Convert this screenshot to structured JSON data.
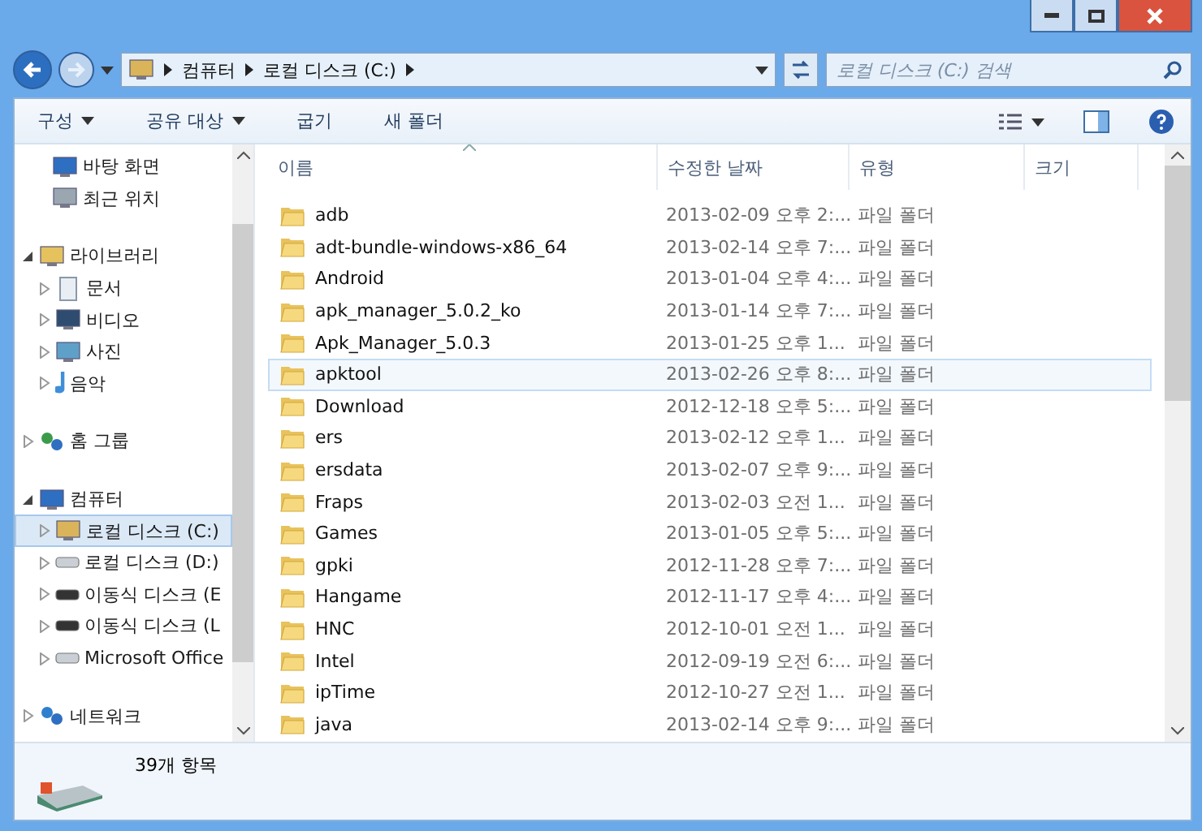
{
  "address": {
    "crumbs": [
      "컴퓨터",
      "로컬 디스크 (C:)"
    ]
  },
  "search": {
    "placeholder": "로컬 디스크 (C:) 검색"
  },
  "toolbar": [
    {
      "label": "구성",
      "dropdown": true
    },
    {
      "label": "공유 대상",
      "dropdown": true
    },
    {
      "label": "굽기",
      "dropdown": false
    },
    {
      "label": "새 폴더",
      "dropdown": false
    }
  ],
  "nav": {
    "favorites": [
      {
        "label": "바탕 화면",
        "kind": "desktop"
      },
      {
        "label": "최근 위치",
        "kind": "recent"
      }
    ],
    "tree": [
      {
        "label": "라이브러리",
        "kind": "library",
        "expanded": true,
        "selected": false,
        "children": [
          {
            "label": "문서",
            "kind": "documents",
            "expanded": false,
            "selected": false
          },
          {
            "label": "비디오",
            "kind": "video",
            "expanded": false,
            "selected": false
          },
          {
            "label": "사진",
            "kind": "pictures",
            "expanded": false,
            "selected": false
          },
          {
            "label": "음악",
            "kind": "music",
            "expanded": false,
            "selected": false
          }
        ]
      },
      {
        "label": "홈 그룹",
        "kind": "homegroup",
        "expanded": false,
        "selected": false
      },
      {
        "label": "컴퓨터",
        "kind": "computer",
        "expanded": true,
        "selected": false,
        "children": [
          {
            "label": "로컬 디스크 (C:)",
            "kind": "systemdisk",
            "expanded": false,
            "selected": true
          },
          {
            "label": "로컬 디스크 (D:)",
            "kind": "disk",
            "expanded": false,
            "selected": false
          },
          {
            "label": "이동식 디스크 (E",
            "kind": "removable",
            "expanded": false,
            "selected": false
          },
          {
            "label": "이동식 디스크 (L",
            "kind": "removable",
            "expanded": false,
            "selected": false
          },
          {
            "label": "Microsoft Office",
            "kind": "disk",
            "expanded": false,
            "selected": false
          }
        ]
      },
      {
        "label": "네트워크",
        "kind": "network",
        "expanded": false,
        "selected": false
      }
    ]
  },
  "table": {
    "columns": [
      {
        "label": "이름",
        "sorted": true
      },
      {
        "label": "수정한 날짜",
        "sorted": false
      },
      {
        "label": "유형",
        "sorted": false
      },
      {
        "label": "크기",
        "sorted": false
      }
    ],
    "rows": [
      {
        "name": "adb",
        "date": "2013-02-09 오후 2:...",
        "type": "파일 폴더",
        "selected": false
      },
      {
        "name": "adt-bundle-windows-x86_64",
        "date": "2013-02-14 오후 7:...",
        "type": "파일 폴더",
        "selected": false
      },
      {
        "name": "Android",
        "date": "2013-01-04 오후 4:...",
        "type": "파일 폴더",
        "selected": false
      },
      {
        "name": "apk_manager_5.0.2_ko",
        "date": "2013-01-14 오후 7:...",
        "type": "파일 폴더",
        "selected": false
      },
      {
        "name": "Apk_Manager_5.0.3",
        "date": "2013-01-25 오후 1...",
        "type": "파일 폴더",
        "selected": false
      },
      {
        "name": "apktool",
        "date": "2013-02-26 오후 8:...",
        "type": "파일 폴더",
        "selected": true
      },
      {
        "name": "Download",
        "date": "2012-12-18 오후 5:...",
        "type": "파일 폴더",
        "selected": false
      },
      {
        "name": "ers",
        "date": "2013-02-12 오후 1...",
        "type": "파일 폴더",
        "selected": false
      },
      {
        "name": "ersdata",
        "date": "2013-02-07 오후 9:...",
        "type": "파일 폴더",
        "selected": false
      },
      {
        "name": "Fraps",
        "date": "2013-02-03 오전 1...",
        "type": "파일 폴더",
        "selected": false
      },
      {
        "name": "Games",
        "date": "2013-01-05 오후 5:...",
        "type": "파일 폴더",
        "selected": false
      },
      {
        "name": "gpki",
        "date": "2012-11-28 오후 7:...",
        "type": "파일 폴더",
        "selected": false
      },
      {
        "name": "Hangame",
        "date": "2012-11-17 오후 4:...",
        "type": "파일 폴더",
        "selected": false
      },
      {
        "name": "HNC",
        "date": "2012-10-01 오전 1...",
        "type": "파일 폴더",
        "selected": false
      },
      {
        "name": "Intel",
        "date": "2012-09-19 오전 6:...",
        "type": "파일 폴더",
        "selected": false
      },
      {
        "name": "ipTime",
        "date": "2012-10-27 오전 1...",
        "type": "파일 폴더",
        "selected": false
      },
      {
        "name": "java",
        "date": "2013-02-14 오후 9:...",
        "type": "파일 폴더",
        "selected": false
      }
    ]
  },
  "status_bar": {
    "text": "39개 항목"
  }
}
